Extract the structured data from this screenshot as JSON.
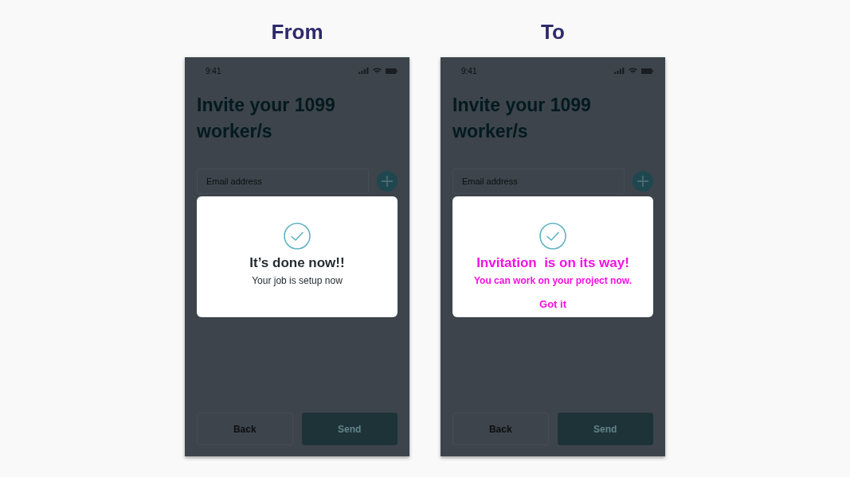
{
  "panels": [
    {
      "heading": "From",
      "phone": {
        "status_bar": {
          "time": "9:41"
        },
        "title": "Invite your 1099 worker/s",
        "email_field": {
          "placeholder": "Email address"
        },
        "dialog": {
          "color": "#252c31",
          "title": "It’s done now!!",
          "message": "Your job is setup now"
        },
        "buttons": [
          {
            "label": "Back",
            "kind": "secondary"
          },
          {
            "label": "Send",
            "kind": "primary"
          }
        ]
      }
    },
    {
      "heading": "To",
      "phone": {
        "status_bar": {
          "time": "9:41"
        },
        "title": "Invite your 1099 worker/s",
        "email_field": {
          "placeholder": "Email address"
        },
        "dialog": {
          "color": "#f510e3",
          "title": "Invitation  is on its way!",
          "message": "You can work on your project now.",
          "action": "Got it"
        },
        "buttons": [
          {
            "label": "Back",
            "kind": "secondary"
          },
          {
            "label": "Send",
            "kind": "primary"
          }
        ]
      }
    }
  ]
}
